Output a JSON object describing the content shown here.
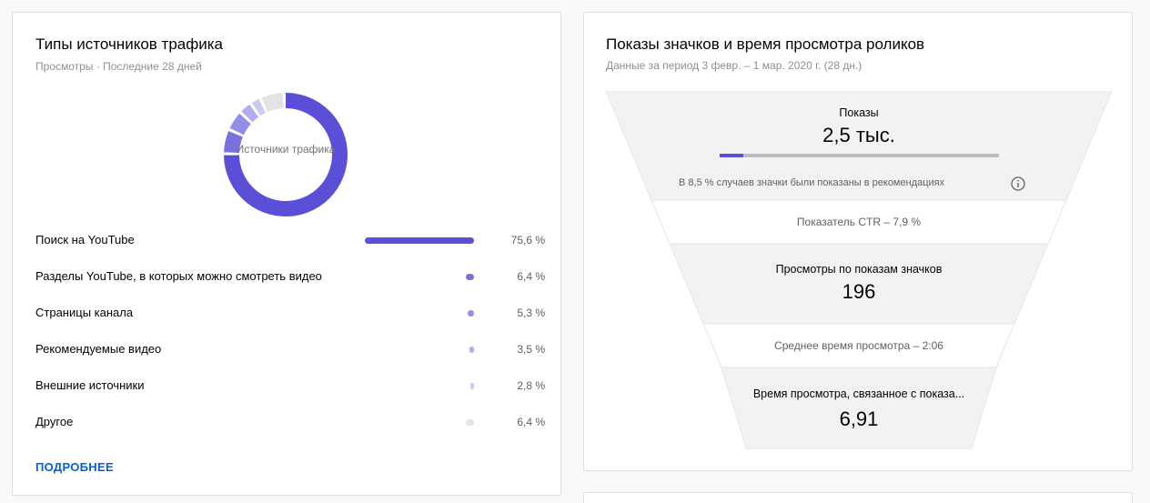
{
  "traffic": {
    "title": "Типы источников трафика",
    "subtitle": "Просмотры · Последние 28 дней",
    "donut_label": "Источники трафика",
    "accent": "#5a4fd6",
    "sources": [
      {
        "name": "Поиск на YouTube",
        "percent": "75,6 %",
        "share": 75.6,
        "color": "#5a4fd6"
      },
      {
        "name": "Разделы YouTube, в которых можно смотреть видео",
        "percent": "6,4 %",
        "share": 6.4,
        "color": "#7a70df"
      },
      {
        "name": "Страницы канала",
        "percent": "5,3 %",
        "share": 5.3,
        "color": "#958ee6"
      },
      {
        "name": "Рекомендуемые видео",
        "percent": "3,5 %",
        "share": 3.5,
        "color": "#b1acee"
      },
      {
        "name": "Внешние источники",
        "percent": "2,8 %",
        "share": 2.8,
        "color": "#ccc9f4"
      },
      {
        "name": "Другое",
        "percent": "6,4 %",
        "share": 6.4,
        "color": "#e3e3e3"
      }
    ],
    "more_label": "ПОДРОБНЕЕ"
  },
  "funnel": {
    "title": "Показы значков и время просмотра роликов",
    "subtitle": "Данные за период 3 февр. – 1 мар. 2020 г. (28 дн.)",
    "impressions_label": "Показы",
    "impressions_value": "2,5 тыс.",
    "recommendation_share": 0.085,
    "impressions_note": "В 8,5 % случаев значки были показаны в рекомендациях",
    "ctr_label": "Показатель CTR – 7,9 %",
    "views_label": "Просмотры по показам значков",
    "views_value": "196",
    "avg_duration_label": "Среднее время просмотра – 2:06",
    "watch_time_label": "Время просмотра, связанное с показа...",
    "watch_time_value": "6,91"
  }
}
